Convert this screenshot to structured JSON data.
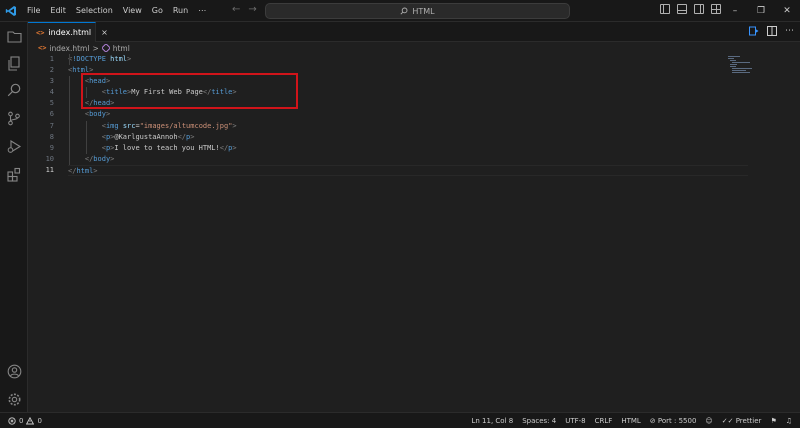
{
  "titlebar": {
    "menu": [
      "File",
      "Edit",
      "Selection",
      "View",
      "Go",
      "Run",
      "⋯"
    ],
    "search_text": "HTML"
  },
  "tab": {
    "label": "index.html",
    "close_glyph": "×"
  },
  "breadcrumb": {
    "file": "index.html",
    "separator": ">",
    "symbol": "html"
  },
  "editor": {
    "line_numbers": [
      "1",
      "2",
      "3",
      "4",
      "5",
      "6",
      "7",
      "8",
      "9",
      "10",
      "11"
    ],
    "active_line": "11",
    "lines": [
      {
        "tokens": [
          [
            "punct",
            "<"
          ],
          [
            "tag",
            "!DOCTYPE"
          ],
          [
            "txt",
            " "
          ],
          [
            "attr",
            "html"
          ],
          [
            "punct",
            ">"
          ]
        ]
      },
      {
        "tokens": [
          [
            "punct",
            "<"
          ],
          [
            "tag",
            "html"
          ],
          [
            "punct",
            ">"
          ]
        ]
      },
      {
        "tokens": [
          [
            "txt",
            "    "
          ],
          [
            "punct",
            "<"
          ],
          [
            "tag",
            "head"
          ],
          [
            "punct",
            ">"
          ]
        ]
      },
      {
        "tokens": [
          [
            "txt",
            "        "
          ],
          [
            "punct",
            "<"
          ],
          [
            "tag",
            "title"
          ],
          [
            "punct",
            ">"
          ],
          [
            "txt",
            "My First Web Page"
          ],
          [
            "punct",
            "</"
          ],
          [
            "tag",
            "title"
          ],
          [
            "punct",
            ">"
          ]
        ]
      },
      {
        "tokens": [
          [
            "txt",
            "    "
          ],
          [
            "punct",
            "</"
          ],
          [
            "tag",
            "head"
          ],
          [
            "punct",
            ">"
          ]
        ]
      },
      {
        "tokens": [
          [
            "txt",
            "    "
          ],
          [
            "punct",
            "<"
          ],
          [
            "tag",
            "body"
          ],
          [
            "punct",
            ">"
          ]
        ]
      },
      {
        "tokens": [
          [
            "txt",
            "        "
          ],
          [
            "punct",
            "<"
          ],
          [
            "tag",
            "img"
          ],
          [
            "txt",
            " "
          ],
          [
            "attr",
            "src"
          ],
          [
            "txt",
            "="
          ],
          [
            "str",
            "\"images/altumcode.jpg\""
          ],
          [
            "punct",
            ">"
          ]
        ]
      },
      {
        "tokens": [
          [
            "txt",
            "        "
          ],
          [
            "punct",
            "<"
          ],
          [
            "tag",
            "p"
          ],
          [
            "punct",
            ">"
          ],
          [
            "txt",
            "@KarlgustaAnnoh"
          ],
          [
            "punct",
            "</"
          ],
          [
            "tag",
            "p"
          ],
          [
            "punct",
            ">"
          ]
        ]
      },
      {
        "tokens": [
          [
            "txt",
            "        "
          ],
          [
            "punct",
            "<"
          ],
          [
            "tag",
            "p"
          ],
          [
            "punct",
            ">"
          ],
          [
            "txt",
            "I love to teach you HTML!"
          ],
          [
            "punct",
            "</"
          ],
          [
            "tag",
            "p"
          ],
          [
            "punct",
            ">"
          ]
        ]
      },
      {
        "tokens": [
          [
            "txt",
            "    "
          ],
          [
            "punct",
            "</"
          ],
          [
            "tag",
            "body"
          ],
          [
            "punct",
            ">"
          ]
        ]
      },
      {
        "tokens": [
          [
            "punct",
            "</"
          ],
          [
            "tag",
            "html"
          ],
          [
            "punct",
            ">"
          ]
        ]
      }
    ]
  },
  "statusbar": {
    "errors": "0",
    "warnings": "0",
    "position": "Ln 11, Col 8",
    "spaces": "Spaces: 4",
    "encoding": "UTF-8",
    "eol": "CRLF",
    "language": "HTML",
    "port": "Port : 5500",
    "prettier": "Prettier"
  },
  "colors": {
    "accent": "#0078d4",
    "highlight_box": "#d0141a",
    "tag": "#569cd6",
    "attribute": "#9cdcfe",
    "string": "#ce9178",
    "html_icon": "#e37933"
  }
}
